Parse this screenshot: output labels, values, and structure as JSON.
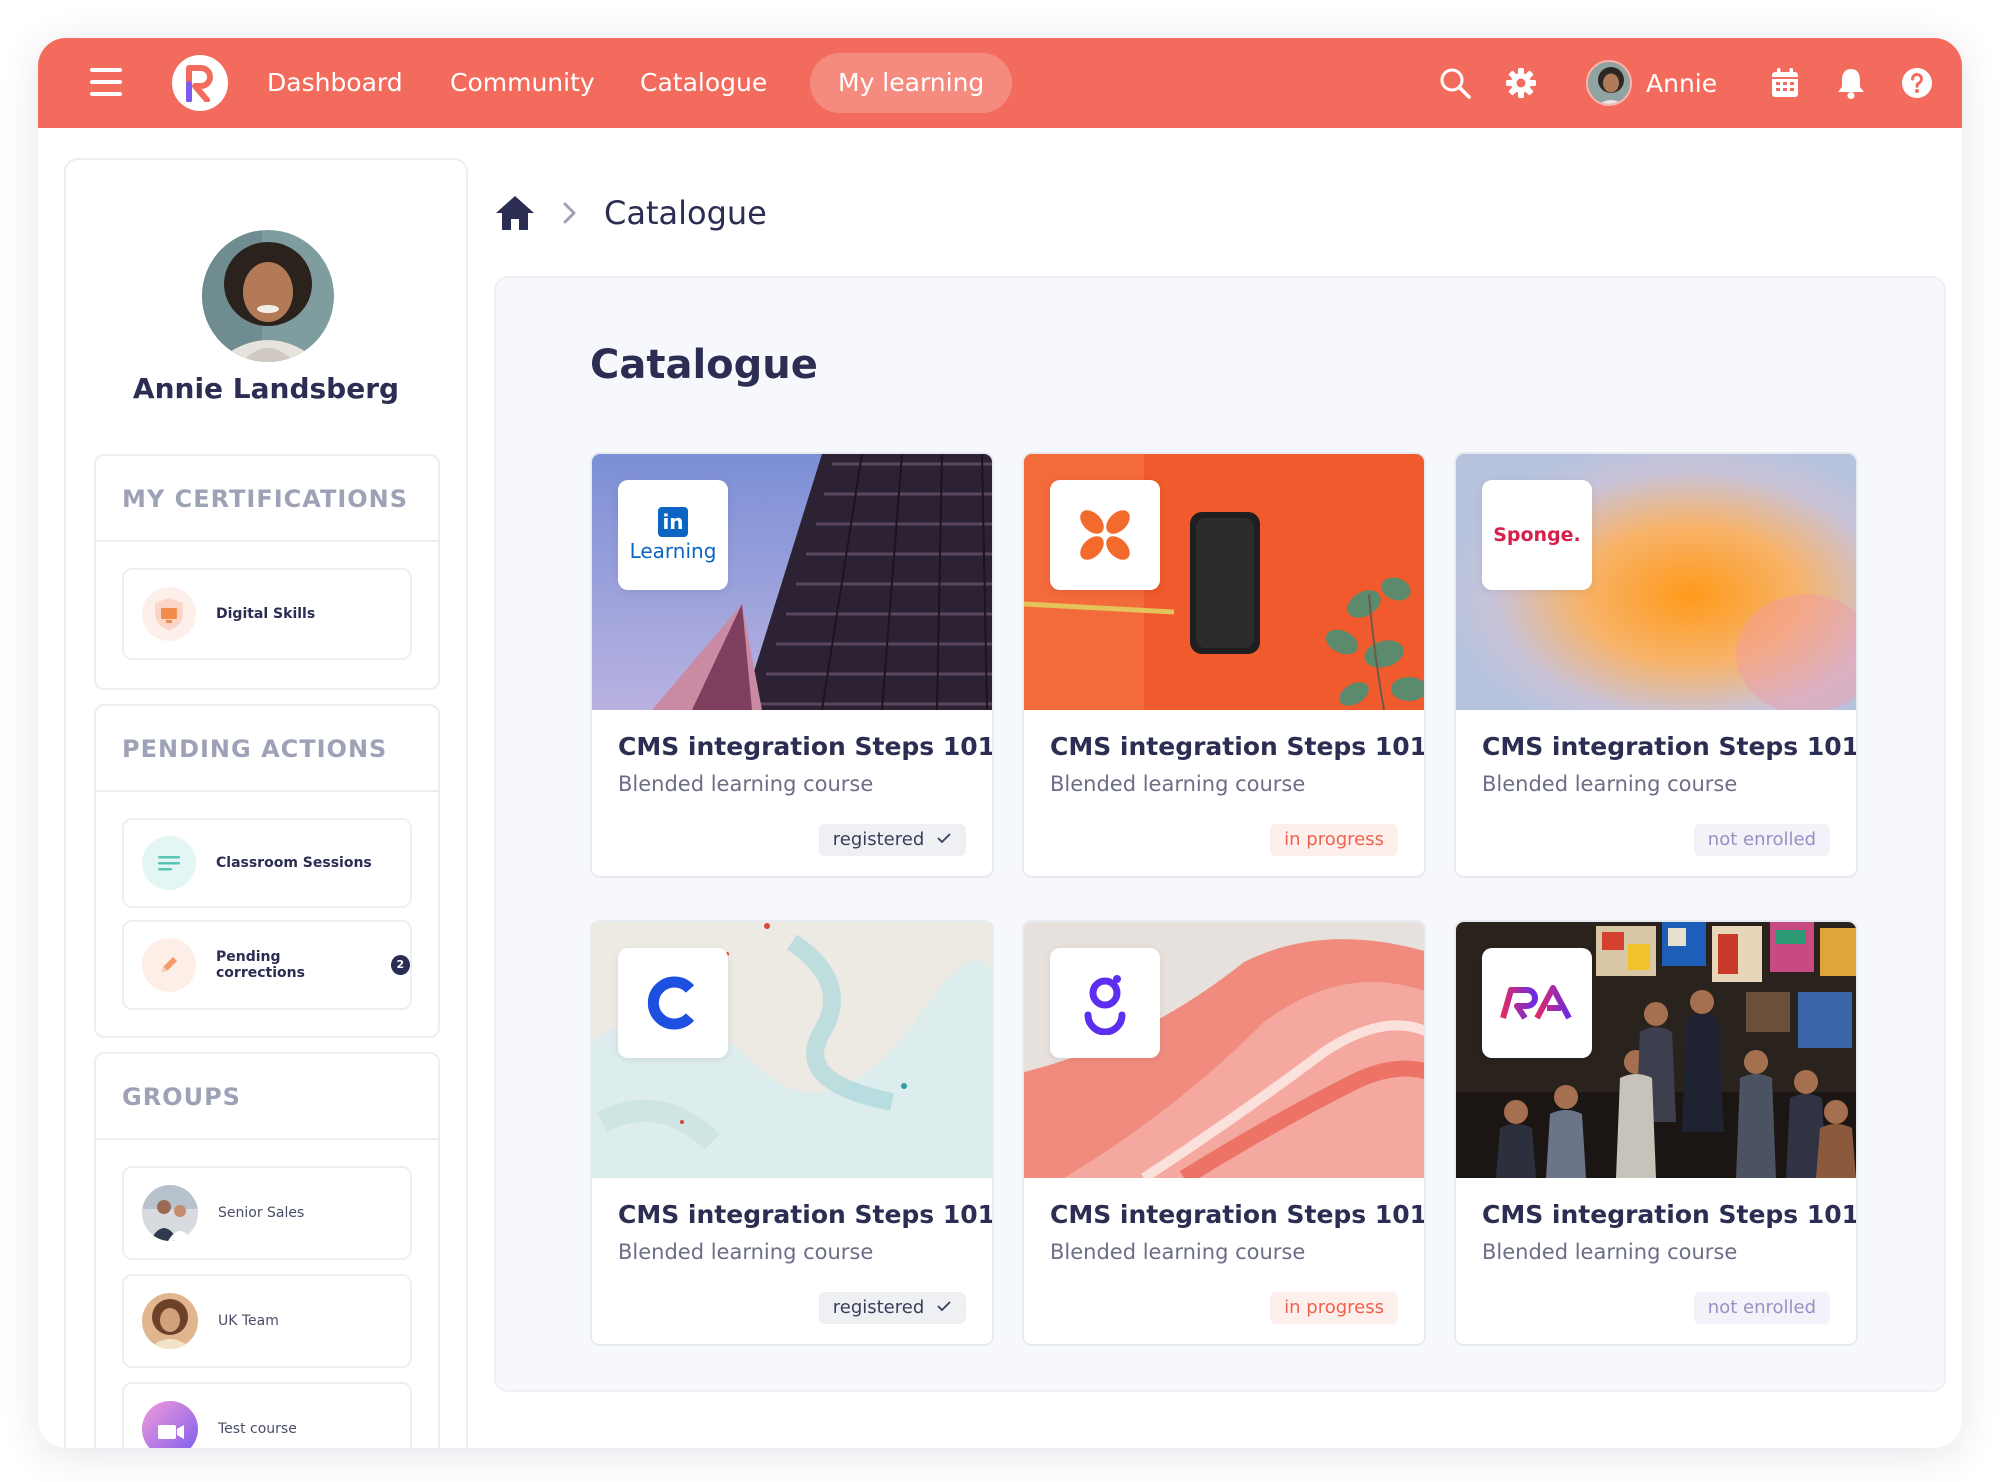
{
  "nav": {
    "items": [
      "Dashboard",
      "Community",
      "Catalogue"
    ],
    "active": "My learning",
    "user_name": "Annie",
    "icons": [
      "search-icon",
      "gear-icon",
      "calendar-icon",
      "bell-icon",
      "help-icon"
    ]
  },
  "sidebar": {
    "profile_name": "Annie Landsberg",
    "certifications": {
      "heading": "MY CERTIFICATIONS",
      "items": [
        {
          "label": "Digital Skills",
          "icon": "monitor-shield-icon"
        }
      ]
    },
    "pending": {
      "heading": "PENDING ACTIONS",
      "items": [
        {
          "label": "Classroom Sessions",
          "icon": "list-icon"
        },
        {
          "label": "Pending corrections",
          "icon": "pencil-icon",
          "badge": "2"
        }
      ]
    },
    "groups": {
      "heading": "GROUPS",
      "items": [
        {
          "label": "Senior Sales"
        },
        {
          "label": "UK Team"
        },
        {
          "label": "Test course"
        }
      ]
    }
  },
  "breadcrumb": {
    "current": "Catalogue"
  },
  "main": {
    "title": "Catalogue",
    "cards": [
      {
        "title": "CMS integration Steps 101",
        "subtitle": "Blended learning course",
        "status": "registered",
        "brand_text": "Learning"
      },
      {
        "title": "CMS integration Steps 101",
        "subtitle": "Blended learning course",
        "status": "in progress"
      },
      {
        "title": "CMS integration Steps 101",
        "subtitle": "Blended learning course",
        "status": "not enrolled",
        "brand_text": "Sponge."
      },
      {
        "title": "CMS integration Steps 101",
        "subtitle": "Blended learning course",
        "status": "registered"
      },
      {
        "title": "CMS integration Steps 101",
        "subtitle": "Blended learning course",
        "status": "in progress"
      },
      {
        "title": "CMS integration Steps 101",
        "subtitle": "Blended learning course",
        "status": "not enrolled"
      }
    ]
  },
  "colors": {
    "accent": "#f36b5c",
    "navy": "#2b2d52"
  }
}
